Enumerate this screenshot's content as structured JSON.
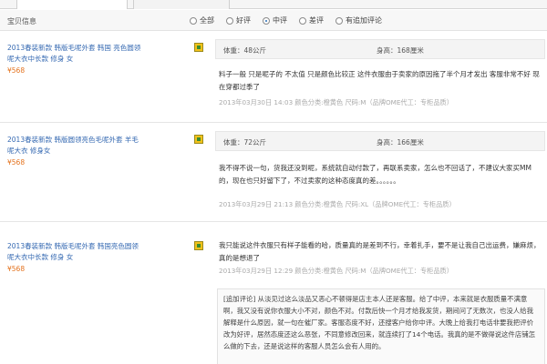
{
  "tabs": {
    "tab1": "",
    "tab2": ""
  },
  "filter": {
    "label": "宝贝信息",
    "options": [
      "全部",
      "好评",
      "中评",
      "差评",
      "有追加评论"
    ],
    "selected_index": 2
  },
  "reviews": [
    {
      "product_title": "2013春装新款 韩版毛呢外套 韩国 亮色圆领呢大衣中长款 修身 女",
      "price": "¥568",
      "weight": "体重：48公斤",
      "height": "身高：168厘米",
      "comment": "料子一般 只是呢子的 不太值 只是颜色比较正 这件衣服由于卖家的原因拖了半个月才发出 客服非常不好 现在穿都过季了",
      "meta": "2013年03月30日 14:03 颜色分类:橙黄色  尺码:M（品牌OME代工：专柜品质）"
    },
    {
      "product_title": "2013春装新款 韩版圆领亮色毛呢外套 羊毛呢大衣 修身女",
      "price": "¥568",
      "weight": "体重：72公斤",
      "height": "身高：166厘米",
      "comment": "我不得不说一句，货我还没到呢，系统就自动付款了，再联系卖家，怎么也不回话了，不建议大家买MM的，现在也只好留下了，不过卖家的这种态度真的差。。。。。。",
      "meta": "2013年03月29日 21:13 颜色分类:橙黄色  尺码:XL（品牌OME代工：专柜品质）"
    },
    {
      "product_title": "2013春装新款 韩版毛呢外套 韩国亮色圆领呢大衣中长款 修身 女",
      "price": "¥568",
      "comment": "我只能说这件衣服只有样子能看的哈，质量真的是差到不行，幸着扎手，要不是让我自己出运费，嫌麻烦，真的是想退了",
      "meta": "2013年03月29日 12:29 颜色分类:橙黄色  尺码:M（品牌OME代工：专柜品质）",
      "append": "[追加评论] 从淡见过这么淡品又恶心不顿得是店主本人还是客服。给了中评，本来就是衣服质量不满意啊，我又没有说你衣服大小不对，颜色不对。付款后快一个月才给我发货，期间问了无数次，也没人给我解释是什么原因，就一句在催厂家。客服态度不好，还搜客户给你中评。大晚上给我打电话非要我把评价改为好评，居然态度还这么恶张，不同意修改回来，就连续打了14个电话。我真的是不做得说这件店铺怎么做的下去，还是说这样的客服人员怎么会有人用的。"
    }
  ]
}
